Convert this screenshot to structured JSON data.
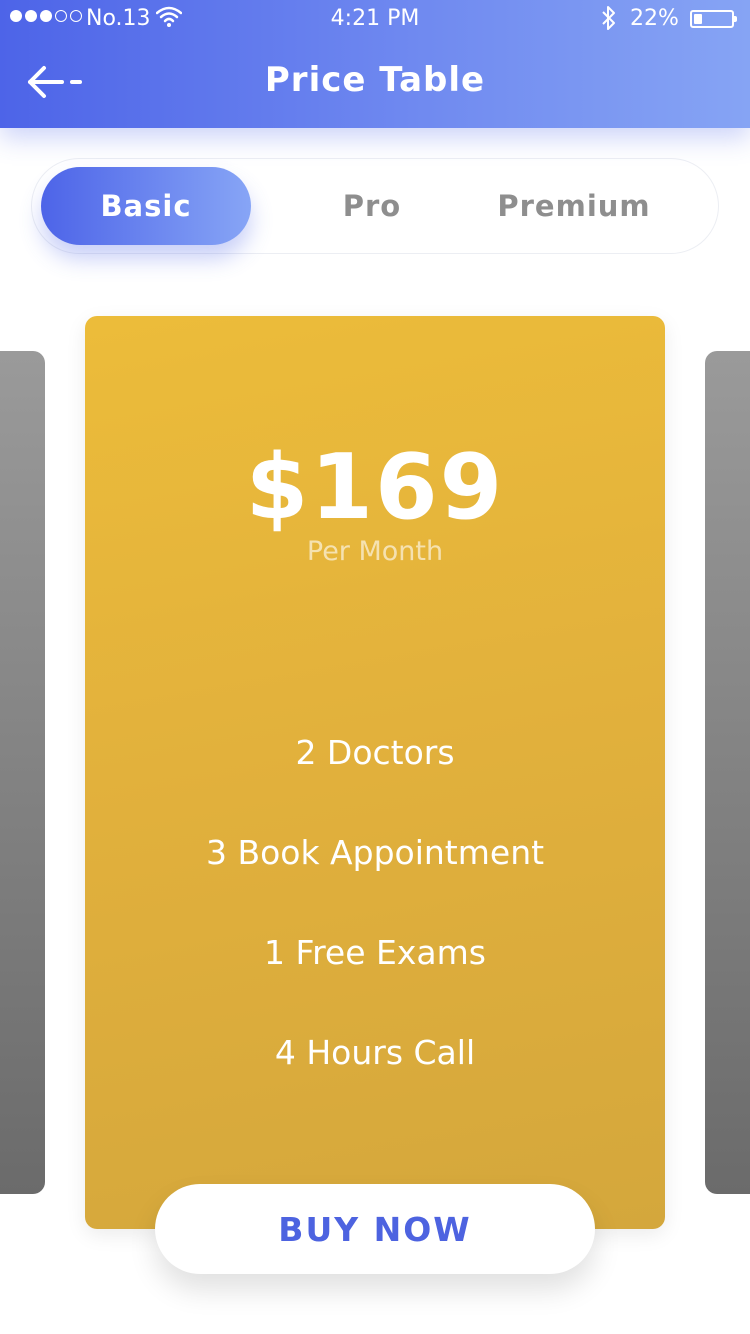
{
  "status_bar": {
    "carrier": "No.13",
    "time": "4:21 PM",
    "battery": "22%",
    "battery_level": 0.22
  },
  "header": {
    "title": "Price Table",
    "back_icon": "arrow-left-icon"
  },
  "tabs": [
    {
      "label": "Basic",
      "active": true
    },
    {
      "label": "Pro",
      "active": false
    },
    {
      "label": "Premium",
      "active": false
    }
  ],
  "plan": {
    "price": "$169",
    "period": "Per Month",
    "features": [
      "2 Doctors",
      "3 Book Appointment",
      "1 Free Exams",
      "4 Hours Call"
    ],
    "buy_label": "BUY NOW"
  },
  "colors": {
    "accent": "#4d64e8",
    "card": "#e4b43c",
    "side_card": "#8a8a8a"
  }
}
